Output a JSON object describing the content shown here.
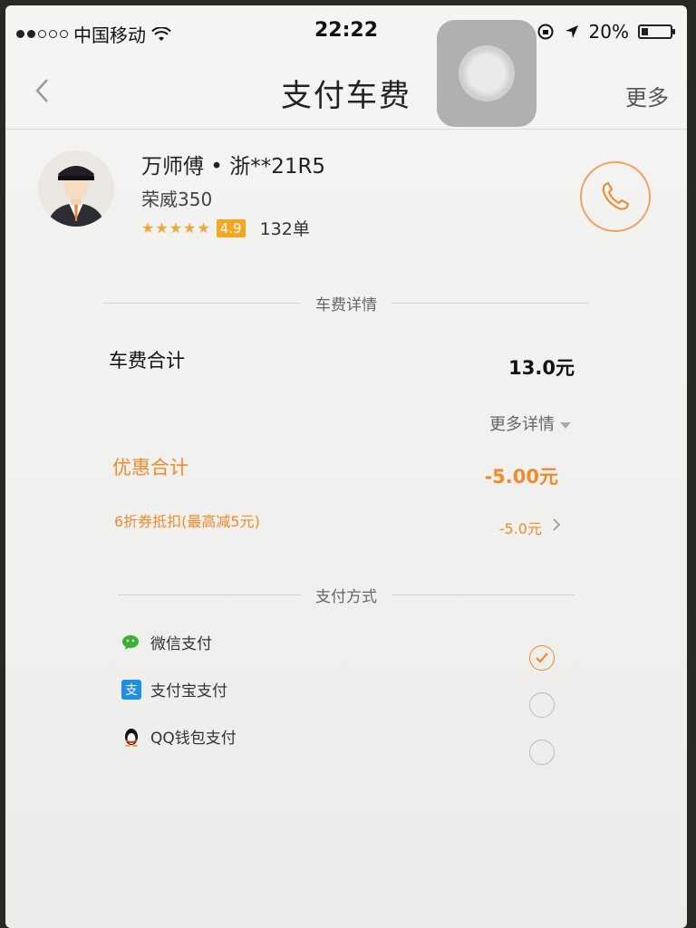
{
  "status_bar": {
    "carrier": "中国移动",
    "time": "22:22",
    "battery": "20%",
    "battery_level": 0.2
  },
  "nav": {
    "back_icon": "chevron-left-icon",
    "title": "支付车费",
    "more_label": "更多"
  },
  "driver": {
    "name": "万师傅 • 浙**21R5",
    "car_model": "荣威350",
    "stars": 5,
    "score": "4.9",
    "orders": "132单"
  },
  "fare": {
    "section_title": "车费详情",
    "total_label": "车费合计",
    "total_value": "13.0元",
    "more_detail_label": "更多详情",
    "discount_label": "优惠合计",
    "discount_value": "-5.00元",
    "coupon_label": "6折券抵扣(最高减5元)",
    "coupon_value": "-5.0元"
  },
  "payment": {
    "section_title": "支付方式",
    "methods": [
      {
        "label": "微信支付",
        "icon": "wechat-icon",
        "selected": true
      },
      {
        "label": "支付宝支付",
        "icon": "alipay-icon",
        "selected": false
      },
      {
        "label": "QQ钱包支付",
        "icon": "qq-penguin-icon",
        "selected": false
      }
    ]
  },
  "colors": {
    "accent": "#f08a2c",
    "star": "#f3a43a",
    "wechat": "#3cb034",
    "alipay": "#1f8fe6"
  }
}
